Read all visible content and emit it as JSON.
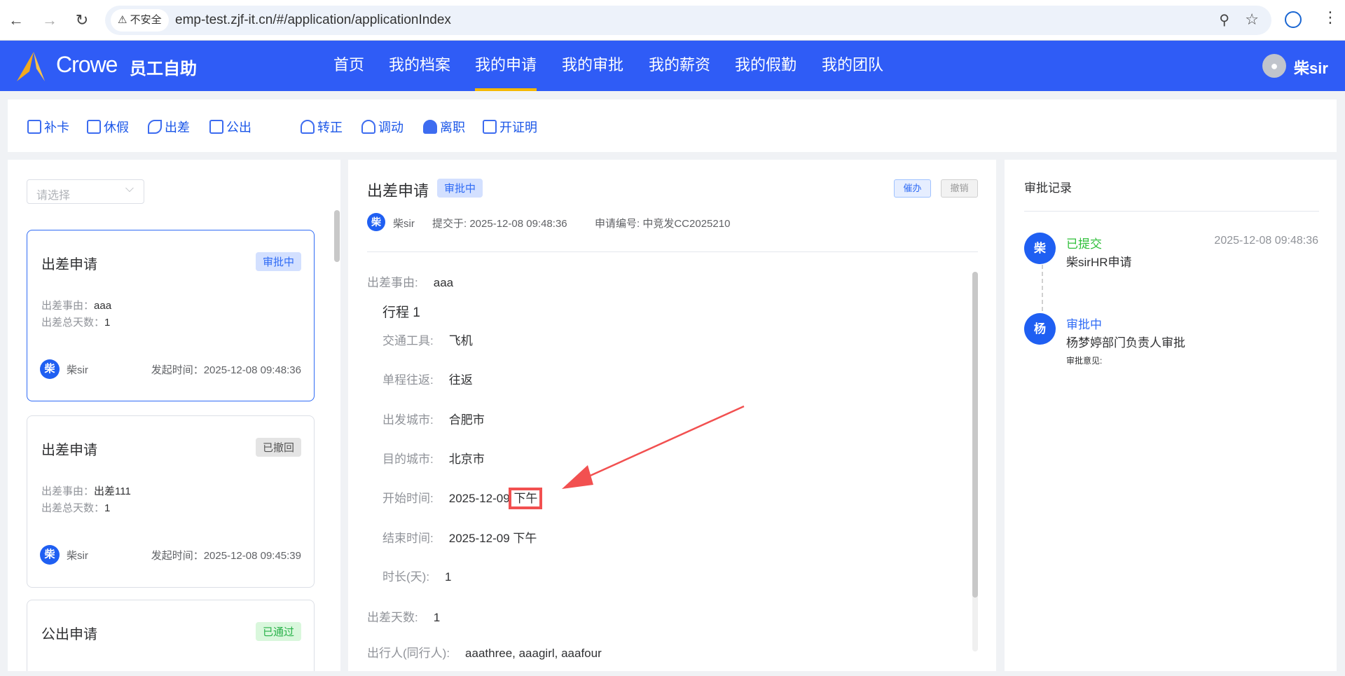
{
  "browser": {
    "security": "不安全",
    "url": "emp-test.zjf-it.cn/#/application/applicationIndex"
  },
  "header": {
    "brand": "Crowe",
    "app_name": "员工自助",
    "user": "柴sir",
    "nav": [
      "首页",
      "我的档案",
      "我的申请",
      "我的审批",
      "我的薪资",
      "我的假勤",
      "我的团队"
    ],
    "active_nav": 2
  },
  "quick_actions": [
    "补卡",
    "休假",
    "出差",
    "公出",
    "转正",
    "调动",
    "离职",
    "开证明"
  ],
  "list": {
    "filter_placeholder": "请选择",
    "cards": [
      {
        "title": "出差申请",
        "status": "审批中",
        "f1_label": "出差事由：",
        "f1_value": "aaa",
        "f2_label": "出差总天数：",
        "f2_value": "1",
        "avatar": "柴",
        "user": "柴sir",
        "time_label": "发起时间：",
        "time": "2025-12-08 09:48:36"
      },
      {
        "title": "出差申请",
        "status": "已撤回",
        "f1_label": "出差事由：",
        "f1_value": "出差111",
        "f2_label": "出差总天数：",
        "f2_value": "1",
        "avatar": "柴",
        "user": "柴sir",
        "time_label": "发起时间：",
        "time": "2025-12-08 09:45:39"
      },
      {
        "title": "公出申请",
        "status": "已通过"
      }
    ]
  },
  "detail": {
    "title": "出差申请",
    "status": "审批中",
    "urge_button": "催办",
    "revoke_button": "撤销",
    "avatar": "柴",
    "user": "柴sir",
    "submitted_label": "提交于:",
    "submitted": "2025-12-08 09:48:36",
    "no_label": "申请编号:",
    "no": "中竞发CC2025210",
    "reason_label": "出差事由:",
    "reason": "aaa",
    "trip_title": "行程 1",
    "trip": [
      {
        "label": "交通工具:",
        "value": "飞机"
      },
      {
        "label": "单程往返:",
        "value": "往返"
      },
      {
        "label": "出发城市:",
        "value": "合肥市"
      },
      {
        "label": "目的城市:",
        "value": "北京市"
      },
      {
        "label": "开始时间:",
        "value": "2025-12-09",
        "suffix": "下午"
      },
      {
        "label": "结束时间:",
        "value": "2025-12-09 下午"
      },
      {
        "label": "时长(天):",
        "value": "1"
      }
    ],
    "days_label": "出差天数:",
    "days": "1",
    "travelers_label": "出行人(同行人):",
    "travelers": "aaathree, aaagirl, aaafour"
  },
  "records": {
    "title": "审批记录",
    "items": [
      {
        "avatar": "柴",
        "status": "已提交",
        "desc": "柴sirHR申请",
        "time": "2025-12-08 09:48:36"
      },
      {
        "avatar": "杨",
        "status": "审批中",
        "desc": "杨梦婷部门负责人审批",
        "opinion_label": "审批意见:"
      }
    ]
  },
  "colors": {
    "brand": "#2f5cf6",
    "accent": "#f5b800",
    "annotation": "#f25050"
  }
}
